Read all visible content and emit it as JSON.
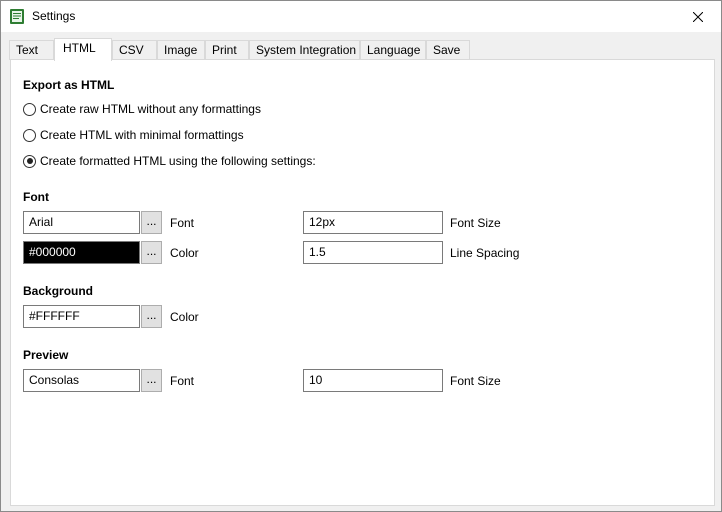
{
  "window": {
    "title": "Settings",
    "close_glyph": "✕"
  },
  "tabs": [
    {
      "label": "Text"
    },
    {
      "label": "HTML",
      "active": true
    },
    {
      "label": "CSV"
    },
    {
      "label": "Image"
    },
    {
      "label": "Print"
    },
    {
      "label": "System Integration"
    },
    {
      "label": "Language"
    },
    {
      "label": "Save"
    }
  ],
  "export": {
    "heading": "Export as HTML",
    "options": [
      {
        "label": "Create raw HTML without any formattings",
        "checked": false
      },
      {
        "label": "Create HTML with minimal formattings",
        "checked": false
      },
      {
        "label": "Create formatted HTML using the following settings:",
        "checked": true
      }
    ]
  },
  "font": {
    "heading": "Font",
    "font_value": "Arial",
    "font_label": "Font",
    "color_value": "#000000",
    "color_label": "Color",
    "size_value": "12px",
    "size_label": "Font Size",
    "spacing_value": "1.5",
    "spacing_label": "Line Spacing",
    "browse_label": "..."
  },
  "background": {
    "heading": "Background",
    "color_value": "#FFFFFF",
    "color_label": "Color",
    "browse_label": "..."
  },
  "preview": {
    "heading": "Preview",
    "font_value": "Consolas",
    "font_label": "Font",
    "size_value": "10",
    "size_label": "Font Size",
    "browse_label": "..."
  },
  "colors": {
    "window_bg": "#f0f0f0",
    "panel_bg": "#ffffff",
    "icon_green": "#2e7d32"
  }
}
